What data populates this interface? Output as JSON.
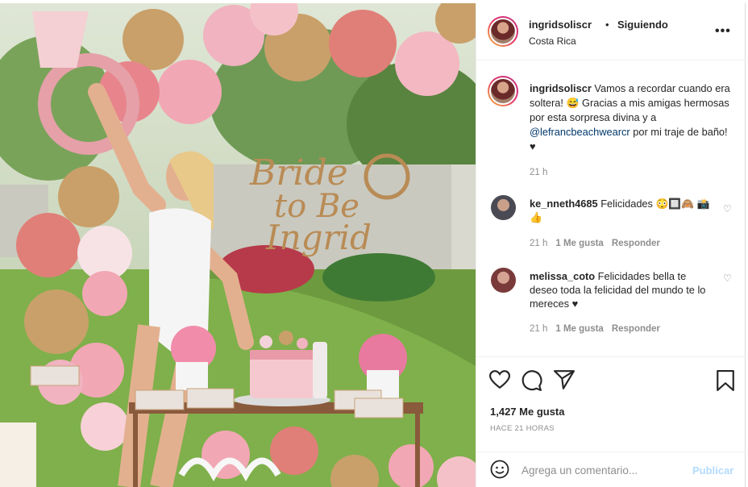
{
  "post": {
    "username": "ingridsoliscr",
    "separator": "•",
    "follow_label": "Siguiendo",
    "location": "Costa Rica",
    "more_label": "•••",
    "photo_text": [
      "Bride",
      "to Be",
      "Ingrid"
    ]
  },
  "caption": {
    "username": "ingridsoliscr",
    "text_1": "Vamos a recordar cuando era soltera! 😅 Gracias a mis amigas hermosas por esta sorpresa divina y a",
    "mention": "@lefrancbeachwearcr",
    "text_2": "por mi traje de baño! ♥",
    "time": "21 h"
  },
  "comments": [
    {
      "username": "ke_nneth4685",
      "text": "Felicidades 😳🔲🙈 📸👍",
      "time": "21 h",
      "likes": "1 Me gusta",
      "reply": "Responder"
    },
    {
      "username": "melissa_coto",
      "text": "Felicidades bella te deseo toda la felicidad del mundo te lo mereces ♥",
      "time": "21 h",
      "likes": "1 Me gusta",
      "reply": "Responder"
    }
  ],
  "actions": {
    "like_icon": "heart-icon",
    "comment_icon": "comment-icon",
    "share_icon": "send-icon",
    "save_icon": "bookmark-icon",
    "likes": "1,427 Me gusta",
    "ago": "HACE 21 HORAS"
  },
  "add_comment": {
    "placeholder": "Agrega un comentario...",
    "publish": "Publicar"
  },
  "colors": {
    "link": "#00376b",
    "publish_disabled": "#b3dbff",
    "muted": "#8e8e8e"
  }
}
